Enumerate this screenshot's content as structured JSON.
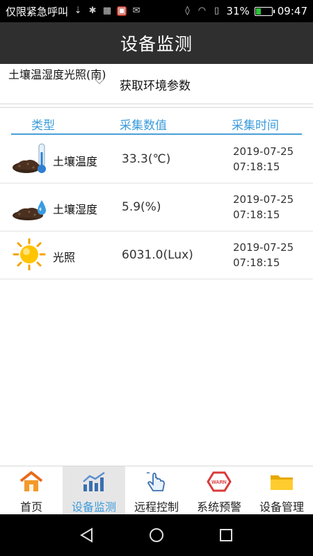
{
  "status_bar": {
    "carrier": "仅限紧急呼叫",
    "battery_percent": "31%",
    "battery_level": 0.31,
    "time": "09:47"
  },
  "header": {
    "title": "设备监测"
  },
  "selector": {
    "value": "土壤温湿度光照(南)"
  },
  "fetch_button": {
    "label": "获取环境参数"
  },
  "table": {
    "headers": [
      "类型",
      "采集数值",
      "采集时间"
    ],
    "rows": [
      {
        "icon": "soil-thermometer-icon",
        "type": "土壤温度",
        "value": "33.3(℃)",
        "date": "2019-07-25",
        "time": "07:18:15"
      },
      {
        "icon": "soil-water-drop-icon",
        "type": "土壤湿度",
        "value": "5.9(%)",
        "date": "2019-07-25",
        "time": "07:18:15"
      },
      {
        "icon": "sun-icon",
        "type": "光照",
        "value": "6031.0(Lux)",
        "date": "2019-07-25",
        "time": "07:18:15"
      }
    ]
  },
  "bottom_nav": [
    {
      "label": "首页",
      "icon": "home-icon"
    },
    {
      "label": "设备监测",
      "icon": "chart-icon",
      "active": true
    },
    {
      "label": "远程控制",
      "icon": "hand-pointer-icon"
    },
    {
      "label": "系统预警",
      "icon": "warn-icon"
    },
    {
      "label": "设备管理",
      "icon": "folder-icon"
    }
  ],
  "colors": {
    "accent": "#3b9bdc",
    "title_bar": "#2f2f2f",
    "active_nav_bg": "#e6e6e6"
  }
}
